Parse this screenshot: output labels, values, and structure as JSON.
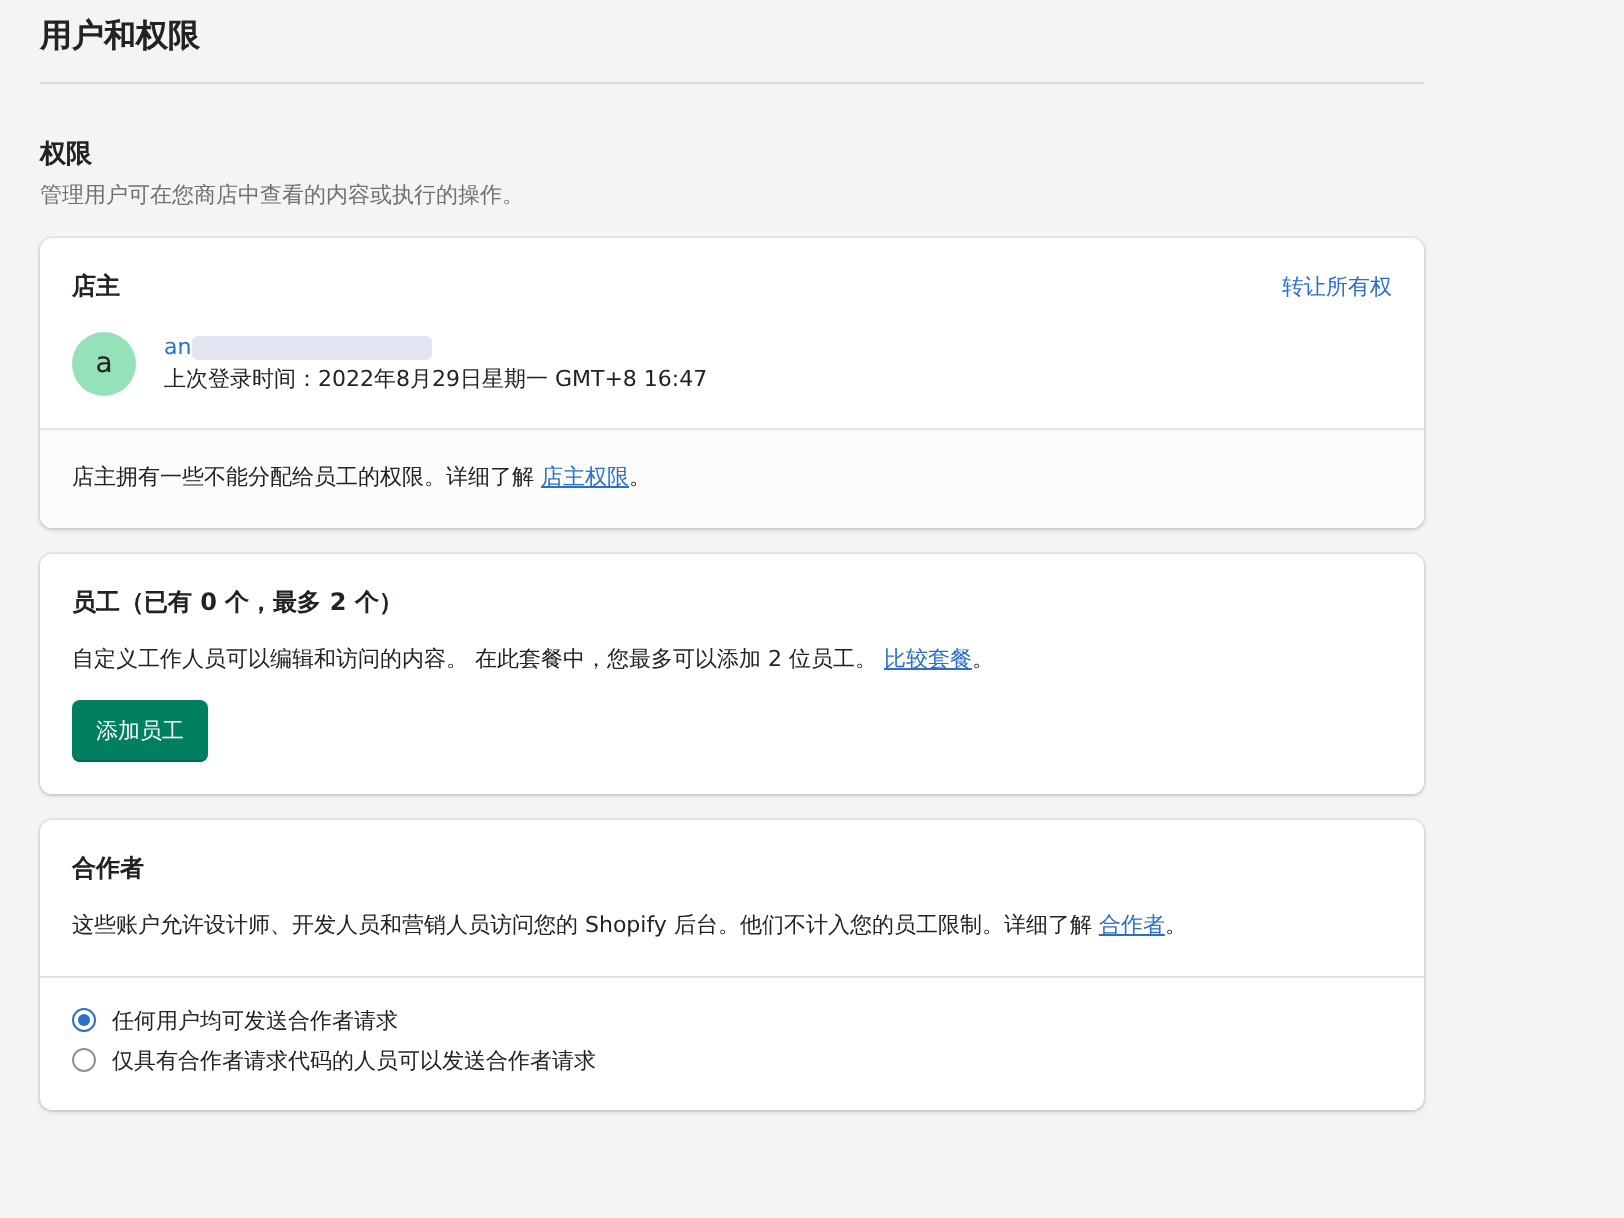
{
  "page_title": "用户和权限",
  "permissions": {
    "title": "权限",
    "description": "管理用户可在您商店中查看的内容或执行的操作。"
  },
  "owner_card": {
    "title": "店主",
    "transfer_link": "转让所有权",
    "avatar_letter": "a",
    "owner_name": "an",
    "last_login": "上次登录时间：2022年8月29日星期一 GMT+8 16:47",
    "footer": {
      "before": "店主拥有一些不能分配给员工的权限。详细了解 ",
      "link": "店主权限",
      "after": "。"
    }
  },
  "staff_card": {
    "title": "员工（已有 0 个，最多 2 个）",
    "description": {
      "before": "自定义工作人员可以编辑和访问的内容。 在此套餐中，您最多可以添加 2 位员工。 ",
      "link": "比较套餐",
      "after": "。"
    },
    "button": "添加员工"
  },
  "collaborators_card": {
    "title": "合作者",
    "description": {
      "before": "这些账户允许设计师、开发人员和营销人员访问您的 Shopify 后台。他们不计入您的员工限制。详细了解 ",
      "link": "合作者",
      "after": "。"
    },
    "options": [
      {
        "label": "任何用户均可发送合作者请求",
        "selected": true
      },
      {
        "label": "仅具有合作者请求代码的人员可以发送合作者请求",
        "selected": false
      }
    ]
  }
}
